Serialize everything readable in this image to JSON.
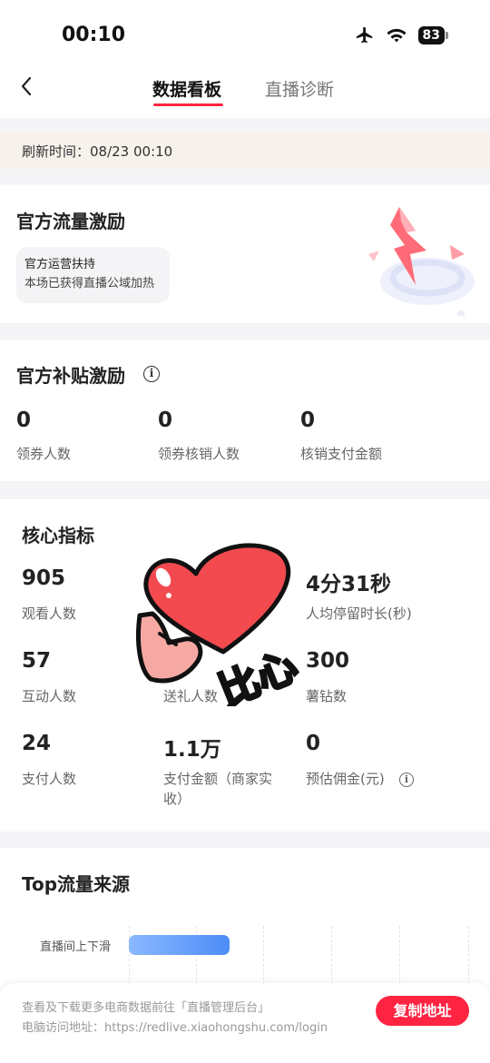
{
  "status_bar": {
    "time": "00:10",
    "battery": "83"
  },
  "nav": {
    "tabs": [
      {
        "label": "数据看板"
      },
      {
        "label": "直播诊断"
      }
    ]
  },
  "refresh": {
    "text": "刷新时间：08/23 00:10"
  },
  "official_traffic": {
    "title": "官方流量激励",
    "box_line1": "官方运营扶持",
    "box_line2": "本场已获得直播公域加热"
  },
  "subsidy": {
    "title": "官方补贴激励",
    "metrics": [
      {
        "value": "0",
        "label": "领券人数"
      },
      {
        "value": "0",
        "label": "领券核销人数"
      },
      {
        "value": "0",
        "label": "核销支付金额"
      }
    ]
  },
  "core": {
    "title": "核心指标",
    "metrics": [
      {
        "value": "905",
        "label": "观看人数"
      },
      {
        "value": "",
        "label": ""
      },
      {
        "value": "4分31秒",
        "label": "人均停留时长(秒)"
      },
      {
        "value": "57",
        "label": "互动人数"
      },
      {
        "value": "",
        "label": "送礼人数"
      },
      {
        "value": "300",
        "label": "薯钻数"
      },
      {
        "value": "24",
        "label": "支付人数"
      },
      {
        "value": "1.1万",
        "label": "支付金额（商家实收）"
      },
      {
        "value": "0",
        "label": "预估佣金(元)"
      }
    ]
  },
  "sticker": {
    "text": "比心"
  },
  "top_sources": {
    "title": "Top流量来源",
    "bars": [
      {
        "label": "直播间上下滑"
      }
    ]
  },
  "bottom": {
    "line1": "查看及下载更多电商数据前往「直播管理后台」",
    "line2": "电脑访问地址：https://redlive.xiaohongshu.com/login",
    "button": "复制地址"
  },
  "colors": {
    "accent": "#ff2442",
    "bar": "#4d8df7",
    "refresh_bg": "#f8f2ec"
  }
}
